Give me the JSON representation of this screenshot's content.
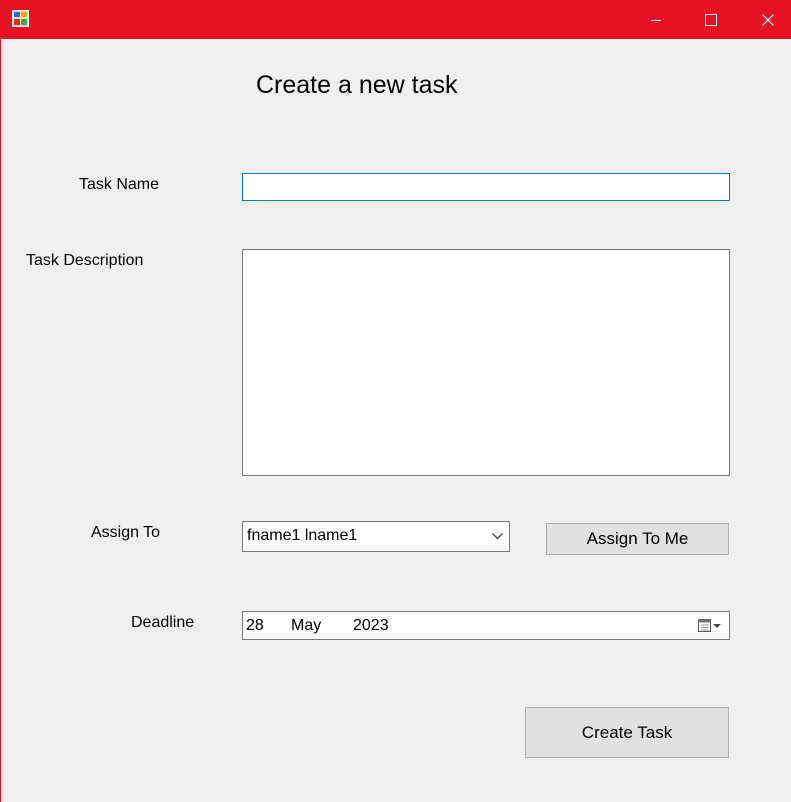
{
  "window": {
    "title": "",
    "icon": "form-app-icon",
    "controls": [
      "minimize-icon",
      "maximize-icon",
      "close-icon"
    ],
    "titlebar_color": "#e81123"
  },
  "form": {
    "heading": "Create a new task",
    "task_name": {
      "label": "Task Name",
      "value": ""
    },
    "task_description": {
      "label": "Task Description",
      "value": ""
    },
    "assign_to": {
      "label": "Assign To",
      "selected": "fname1 lname1",
      "assign_me_label": "Assign To Me"
    },
    "deadline": {
      "label": "Deadline",
      "day": "28",
      "month": "May",
      "year": "2023",
      "icon": "calendar-dropdown-icon"
    },
    "create_button": "Create Task"
  },
  "colors": {
    "focus_border": "#0078d7",
    "client_bg": "#f0f0f0",
    "button_bg": "#e1e1e1"
  }
}
